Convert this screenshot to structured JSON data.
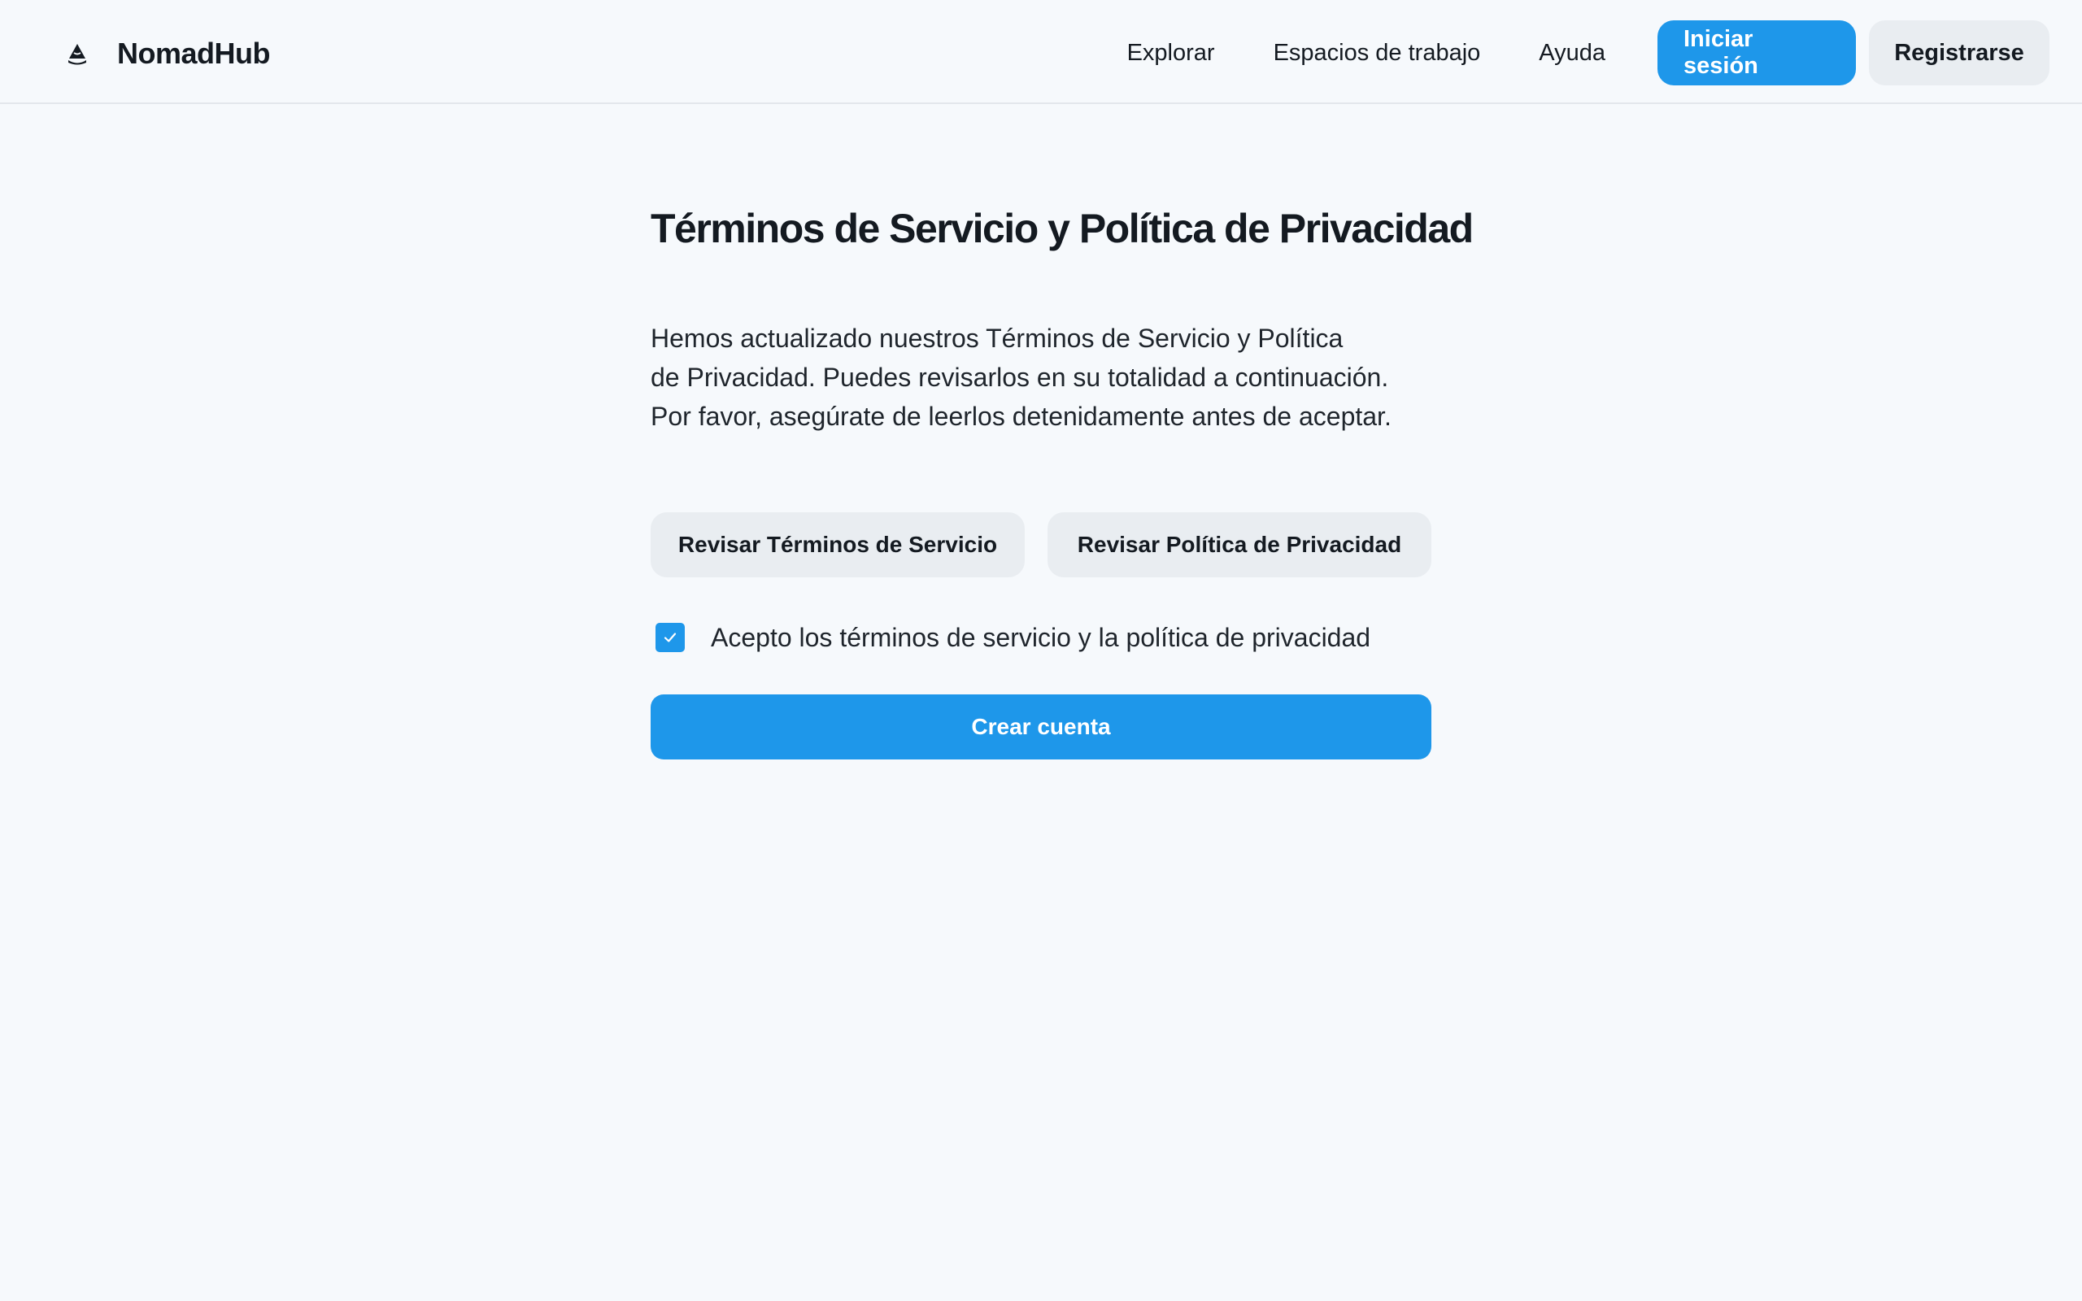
{
  "header": {
    "brand": "NomadHub",
    "brand_icon": "mountain-logo-icon",
    "nav": [
      {
        "label": "Explorar"
      },
      {
        "label": "Espacios de trabajo"
      },
      {
        "label": "Ayuda"
      }
    ],
    "login_label": "Iniciar sesión",
    "register_label": "Registrarse"
  },
  "main": {
    "title": "Términos de Servicio y Política de Privacidad",
    "description_lines": [
      "Hemos actualizado nuestros Términos de Servicio y Política",
      " de Privacidad. Puedes revisarlos en su totalidad a continuación.",
      "Por favor, asegúrate de leerlos detenidamente antes de aceptar."
    ],
    "review_terms_label": "Revisar Términos de Servicio",
    "review_privacy_label": "Revisar Política de Privacidad",
    "accept_label": "Acepto los términos de servicio y la política de privacidad",
    "accept_checked": true,
    "create_label": "Crear cuenta"
  },
  "colors": {
    "primary": "#1e97ea",
    "secondary_bg": "#e9edf1",
    "page_bg": "#f6f9fc",
    "text": "#141a21"
  }
}
